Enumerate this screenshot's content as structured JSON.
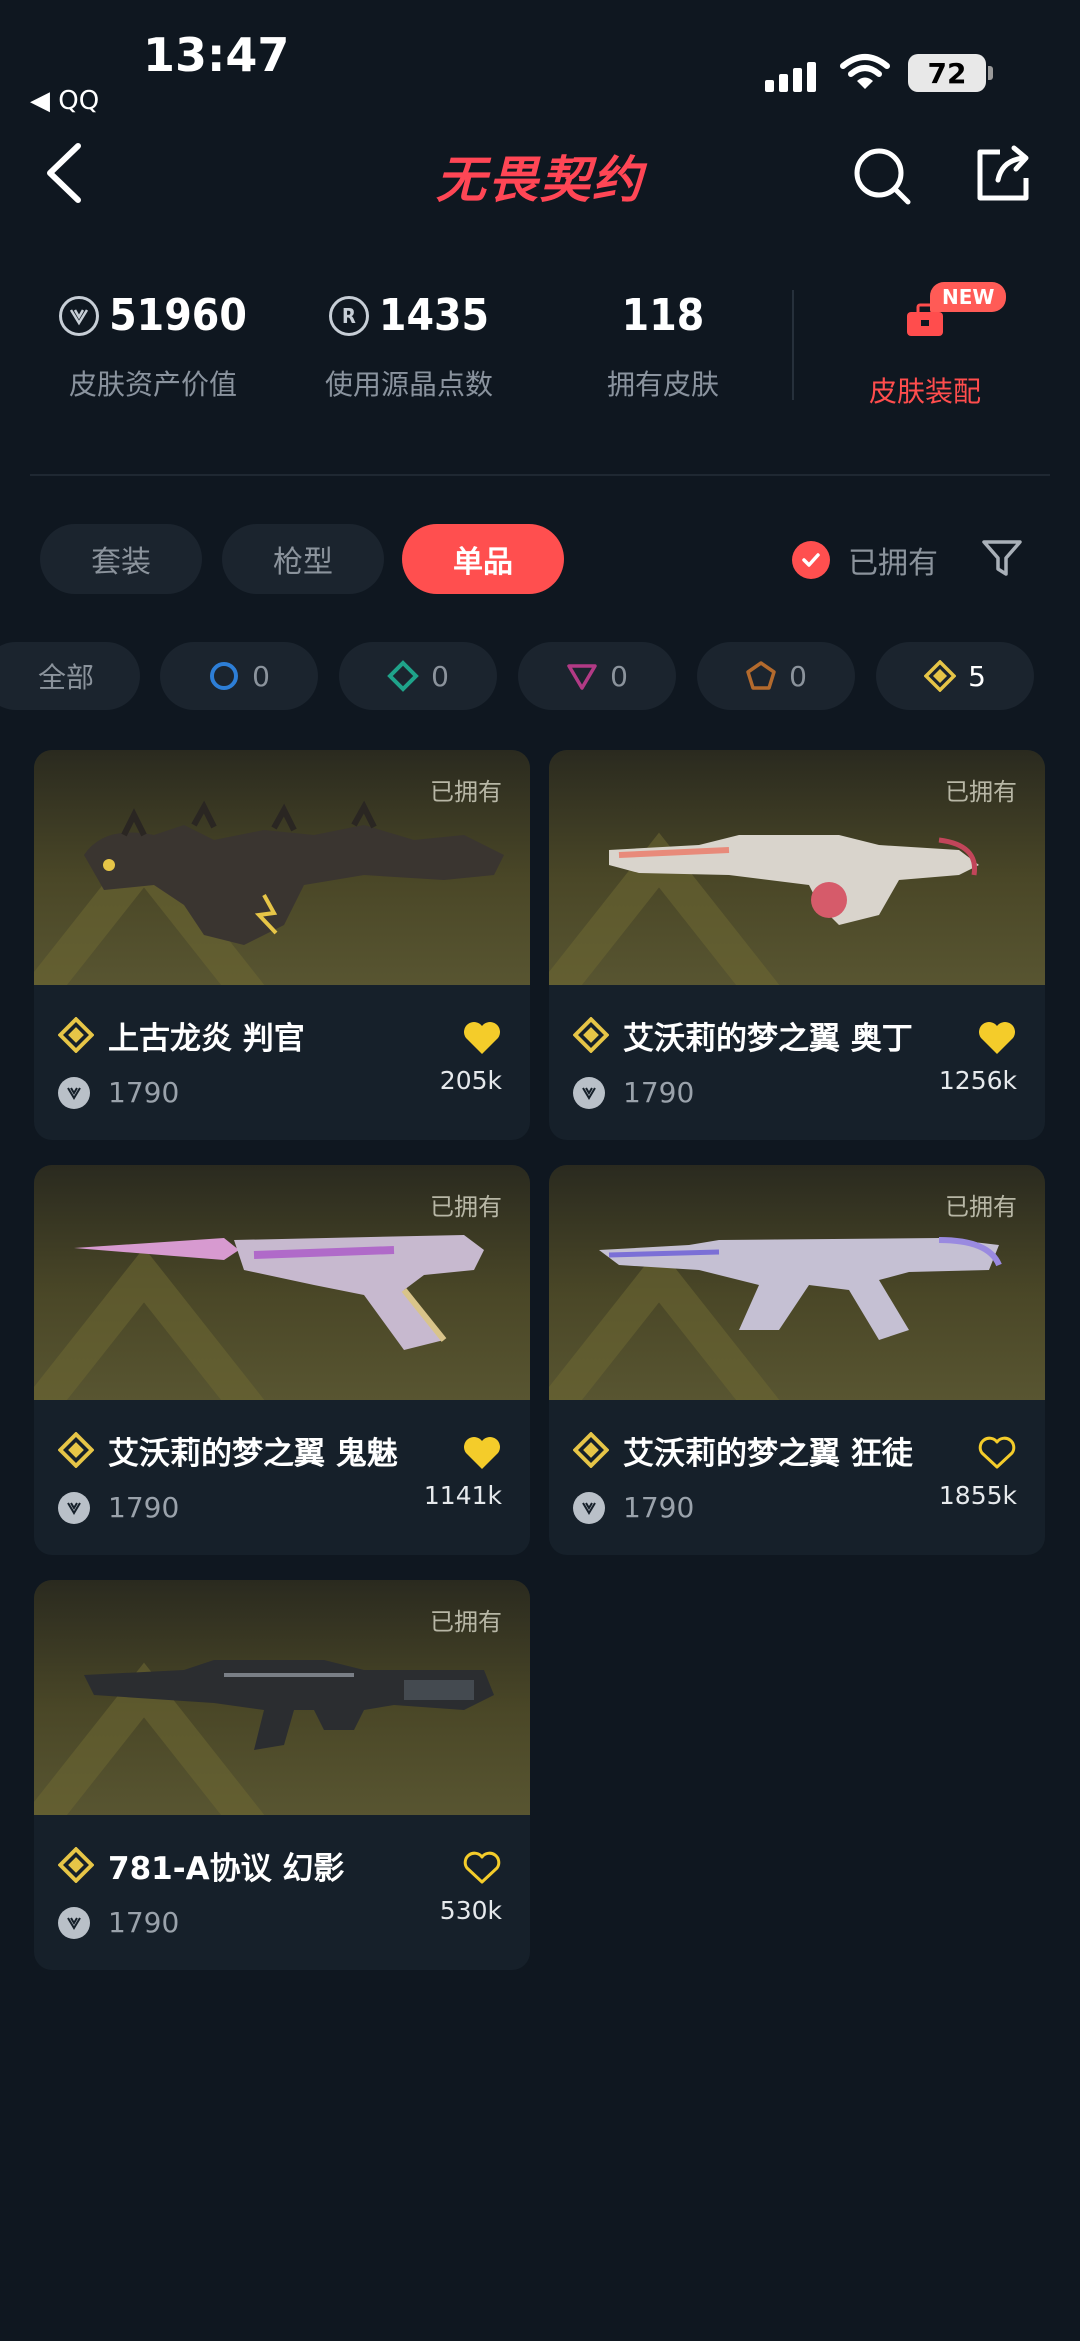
{
  "status_bar": {
    "time": "13:47",
    "back_app": "◀ QQ",
    "battery": "72"
  },
  "header": {
    "title": "无畏契约"
  },
  "stats": [
    {
      "value": "51960",
      "label": "皮肤资产价值",
      "icon": "vp-icon"
    },
    {
      "value": "1435",
      "label": "使用源晶点数",
      "icon": "radianite-icon"
    },
    {
      "value": "118",
      "label": "拥有皮肤"
    }
  ],
  "skin_equip": {
    "label": "皮肤装配",
    "badge": "NEW"
  },
  "tabs": [
    "套装",
    "枪型",
    "单品"
  ],
  "active_tab": "单品",
  "owned_filter": {
    "label": "已拥有",
    "checked": true
  },
  "tier_chips": [
    {
      "label": "全部",
      "count": ""
    },
    {
      "tier": "select",
      "count": "0",
      "color": "#2d7ed6"
    },
    {
      "tier": "deluxe",
      "count": "0",
      "color": "#1fa38a"
    },
    {
      "tier": "premium",
      "count": "0",
      "color": "#b23a85"
    },
    {
      "tier": "ultra",
      "count": "0",
      "color": "#b36a2d"
    },
    {
      "tier": "exclusive",
      "count": "5",
      "color": "#e6c547"
    }
  ],
  "items": [
    {
      "name": "上古龙炎 判官",
      "price": "1790",
      "likes": "205k",
      "owned_label": "已拥有",
      "liked": true
    },
    {
      "name": "艾沃莉的梦之翼 奥丁",
      "price": "1790",
      "likes": "1256k",
      "owned_label": "已拥有",
      "liked": true
    },
    {
      "name": "艾沃莉的梦之翼 鬼魅",
      "price": "1790",
      "likes": "1141k",
      "owned_label": "已拥有",
      "liked": true
    },
    {
      "name": "艾沃莉的梦之翼 狂徒",
      "price": "1790",
      "likes": "1855k",
      "owned_label": "已拥有",
      "liked": false
    },
    {
      "name": "781-A协议 幻影",
      "price": "1790",
      "likes": "530k",
      "owned_label": "已拥有",
      "liked": false
    }
  ],
  "colors": {
    "accent": "#ff4f4f",
    "gold": "#e6c547",
    "background": "#0f1720"
  }
}
